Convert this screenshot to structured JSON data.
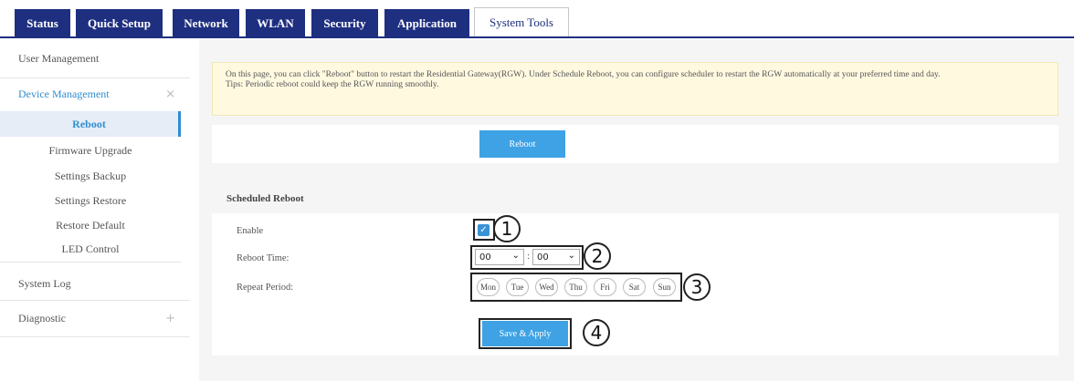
{
  "nav": {
    "tabs": [
      {
        "label": "Status"
      },
      {
        "label": "Quick Setup"
      },
      {
        "label": "Network"
      },
      {
        "label": "WLAN"
      },
      {
        "label": "Security"
      },
      {
        "label": "Application"
      },
      {
        "label": "System Tools"
      }
    ],
    "active_tab": "System Tools"
  },
  "sidebar": {
    "user_management": "User Management",
    "device_management": "Device Management",
    "device_management_items": [
      "Reboot",
      "Firmware Upgrade",
      "Settings Backup",
      "Settings Restore",
      "Restore Default",
      "LED Control"
    ],
    "system_log": "System Log",
    "diagnostic": "Diagnostic",
    "collapse_glyph": "×",
    "expand_glyph": "+"
  },
  "notice": {
    "line1": "On this page, you can click \"Reboot\" button to restart the Residential Gateway(RGW). Under Schedule Reboot, you can configure scheduler to restart the RGW automatically at your preferred time and day.",
    "line2": "Tips: Periodic reboot could keep the RGW running smoothly."
  },
  "reboot_button": "Reboot",
  "scheduled": {
    "title": "Scheduled Reboot",
    "enable_label": "Enable",
    "enable_checked": true,
    "time_label": "Reboot Time:",
    "hour": "00",
    "minute": "00",
    "colon": ":",
    "repeat_label": "Repeat Period:",
    "days": [
      "Mon",
      "Tue",
      "Wed",
      "Thu",
      "Fri",
      "Sat",
      "Sun"
    ],
    "save_button": "Save & Apply"
  },
  "annotations": [
    "1",
    "2",
    "3",
    "4"
  ],
  "colors": {
    "nav_blue": "#1e2f80",
    "accent_blue": "#3ea2e4",
    "notice_bg": "#fff9e0"
  }
}
